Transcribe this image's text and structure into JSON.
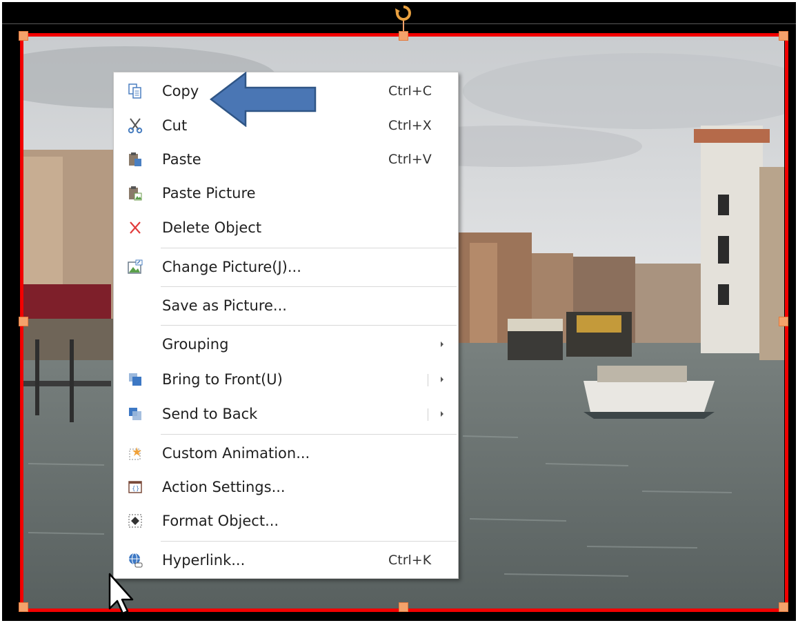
{
  "colors": {
    "selection_border": "#f20000",
    "handle": "#f4a26b",
    "menu_bg": "#ffffff",
    "annotation_arrow": "#4a76b4"
  },
  "context_menu": {
    "items": [
      {
        "label": "Copy",
        "shortcut": "Ctrl+C",
        "icon": "copy-icon"
      },
      {
        "label": "Cut",
        "shortcut": "Ctrl+X",
        "icon": "scissors-icon"
      },
      {
        "label": "Paste",
        "shortcut": "Ctrl+V",
        "icon": "paste-icon"
      },
      {
        "label": "Paste Picture",
        "shortcut": "",
        "icon": "paste-picture-icon"
      },
      {
        "label": "Delete Object",
        "shortcut": "",
        "icon": "delete-x-icon"
      },
      {
        "label": "Change Picture(J)...",
        "shortcut": "",
        "icon": "change-picture-icon"
      },
      {
        "label": "Save as Picture...",
        "shortcut": "",
        "icon": ""
      },
      {
        "label": "Grouping",
        "shortcut": "",
        "icon": "",
        "submenu": true
      },
      {
        "label": "Bring to Front(U)",
        "shortcut": "",
        "icon": "bring-to-front-icon",
        "submenu": true
      },
      {
        "label": "Send to Back",
        "shortcut": "",
        "icon": "send-to-back-icon",
        "submenu": true
      },
      {
        "label": "Custom Animation...",
        "shortcut": "",
        "icon": "custom-animation-icon"
      },
      {
        "label": "Action Settings...",
        "shortcut": "",
        "icon": "action-settings-icon"
      },
      {
        "label": "Format Object...",
        "shortcut": "",
        "icon": "format-object-icon"
      },
      {
        "label": "Hyperlink...",
        "shortcut": "Ctrl+K",
        "icon": "hyperlink-globe-icon"
      }
    ]
  }
}
